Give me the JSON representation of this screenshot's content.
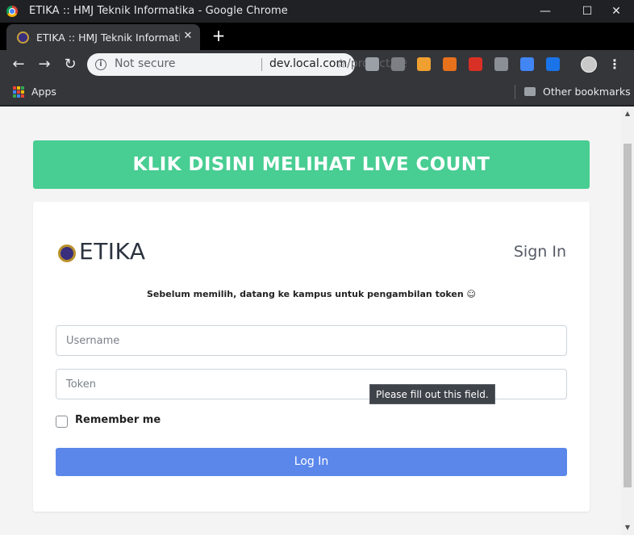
{
  "window": {
    "title": "ETIKA :: HMJ Teknik Informatika - Google Chrome",
    "minimize": "—",
    "maximize": "☐",
    "close": "✕"
  },
  "tab": {
    "title": "ETIKA :: HMJ Teknik Informatika",
    "close": "✕",
    "new_tab": "+"
  },
  "toolbar": {
    "back": "←",
    "forward": "→",
    "reload": "↻",
    "info": "i",
    "security_label": "Not secure",
    "url_host": "dev.local.com",
    "url_path": "/project/pe...",
    "star": "☆",
    "menu": "⋮"
  },
  "extensions": [
    {
      "name": "chat-extension-icon",
      "color": "#9aa0a6"
    },
    {
      "name": "arrow-extension-icon",
      "color": "#7c7f84"
    },
    {
      "name": "owl-extension-icon",
      "color": "#f0a030"
    },
    {
      "name": "music-extension-icon",
      "color": "#e8711c"
    },
    {
      "name": "stop-extension-icon",
      "color": "#d93025"
    },
    {
      "name": "m-extension-icon",
      "color": "#8a8f96"
    },
    {
      "name": "translate-extension-icon",
      "color": "#4285f4"
    },
    {
      "name": "s-extension-icon",
      "color": "#1a73e8"
    }
  ],
  "bookmarks": {
    "apps_label": "Apps",
    "other_label": "Other bookmarks",
    "apps_colors": [
      "#ea4335",
      "#fbbc04",
      "#34a853",
      "#4285f4",
      "#ea4335",
      "#fbbc04",
      "#34a853",
      "#4285f4",
      "#ea4335"
    ]
  },
  "page": {
    "banner_text": "KLIK DISINI MELIHAT LIVE COUNT",
    "logo_text": "ETIKA",
    "sign_in_title": "Sign In",
    "notice": "Sebelum memilih, datang ke kampus untuk pengambilan token ☺",
    "username_placeholder": "Username",
    "username_value": "",
    "token_placeholder": "Token",
    "token_value": "",
    "tooltip": "Please fill out this field.",
    "remember_label": "Remember me",
    "remember_checked": false,
    "login_label": "Log In",
    "colors": {
      "banner": "#48cd92",
      "login_button": "#5b87eb"
    }
  },
  "scrollbar": {
    "up": "▲",
    "down": "▼"
  }
}
